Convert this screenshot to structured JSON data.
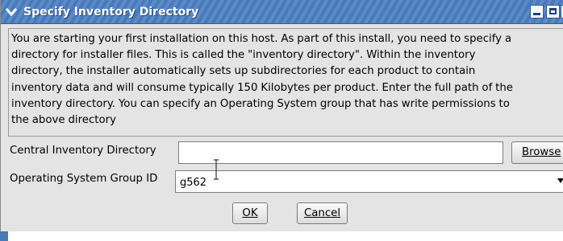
{
  "window": {
    "title": "Specify Inventory Directory"
  },
  "message": "You are starting your first installation on this host. As part of this install, you need to specify a\ndirectory for installer files. This is called the \"inventory directory\". Within the inventory\ndirectory, the installer automatically sets up subdirectories for each product to contain\ninventory data and will consume typically 150 Kilobytes per product. Enter the full path of the\ninventory directory. You can specify an Operating System group that has write permissions to\nthe above directory",
  "form": {
    "inventory_label": "Central Inventory Directory",
    "inventory_value": "",
    "browse_label": "Browse",
    "group_label": "Operating System Group ID",
    "group_value": "g562"
  },
  "buttons": {
    "ok_label": "OK",
    "cancel_label": "Cancel"
  },
  "icons": {
    "window_menu": "chevron-down-icon",
    "minimize": "minimize-icon",
    "maximize": "maximize-icon",
    "close": "close-icon",
    "dropdown": "dropdown-arrow-icon",
    "cursor": "text-cursor-icon"
  },
  "colors": {
    "titlebar": "#4b79b8",
    "dialog_bg": "#e4e4e4"
  }
}
